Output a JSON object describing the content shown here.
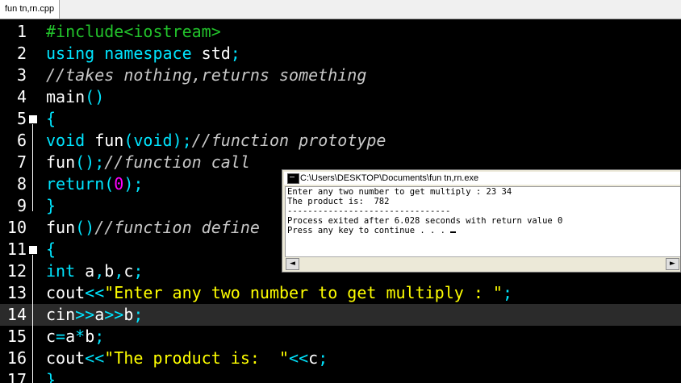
{
  "tab": {
    "label": "fun tn,rn.cpp"
  },
  "editor": {
    "lines": [
      {
        "n": "1",
        "tokens": [
          {
            "t": "#include<iostream>",
            "c": "g"
          }
        ]
      },
      {
        "n": "2",
        "tokens": [
          {
            "t": "using namespace ",
            "c": "cy"
          },
          {
            "t": "std",
            "c": "w"
          },
          {
            "t": ";",
            "c": "cy"
          }
        ]
      },
      {
        "n": "3",
        "tokens": [
          {
            "t": "//takes nothing,returns something",
            "c": "c"
          }
        ]
      },
      {
        "n": "4",
        "tokens": [
          {
            "t": "main",
            "c": "w"
          },
          {
            "t": "()",
            "c": "cy"
          }
        ]
      },
      {
        "n": "5",
        "fold": true,
        "tokens": [
          {
            "t": "{",
            "c": "cy"
          }
        ]
      },
      {
        "n": "6",
        "tokens": [
          {
            "t": "void ",
            "c": "cy"
          },
          {
            "t": "fun",
            "c": "w"
          },
          {
            "t": "(",
            "c": "cy"
          },
          {
            "t": "void",
            "c": "cy"
          },
          {
            "t": ");",
            "c": "cy"
          },
          {
            "t": "//function prototype",
            "c": "c"
          }
        ]
      },
      {
        "n": "7",
        "tokens": [
          {
            "t": "fun",
            "c": "w"
          },
          {
            "t": "();",
            "c": "cy"
          },
          {
            "t": "//function call",
            "c": "c"
          }
        ]
      },
      {
        "n": "8",
        "tokens": [
          {
            "t": "return",
            "c": "cy"
          },
          {
            "t": "(",
            "c": "cy"
          },
          {
            "t": "0",
            "c": "m"
          },
          {
            "t": ");",
            "c": "cy"
          }
        ]
      },
      {
        "n": "9",
        "tokens": [
          {
            "t": "}",
            "c": "cy"
          }
        ]
      },
      {
        "n": "10",
        "tokens": [
          {
            "t": "fun",
            "c": "w"
          },
          {
            "t": "()",
            "c": "cy"
          },
          {
            "t": "//function define",
            "c": "c"
          }
        ]
      },
      {
        "n": "11",
        "fold": true,
        "tokens": [
          {
            "t": "{",
            "c": "cy"
          }
        ]
      },
      {
        "n": "12",
        "tokens": [
          {
            "t": "int ",
            "c": "cy"
          },
          {
            "t": "a",
            "c": "w"
          },
          {
            "t": ",",
            "c": "cy"
          },
          {
            "t": "b",
            "c": "w"
          },
          {
            "t": ",",
            "c": "cy"
          },
          {
            "t": "c",
            "c": "w"
          },
          {
            "t": ";",
            "c": "cy"
          }
        ]
      },
      {
        "n": "13",
        "tokens": [
          {
            "t": "cout",
            "c": "w"
          },
          {
            "t": "<<",
            "c": "cy"
          },
          {
            "t": "\"Enter any two number to get multiply : \"",
            "c": "y"
          },
          {
            "t": ";",
            "c": "cy"
          }
        ]
      },
      {
        "n": "14",
        "current": true,
        "tokens": [
          {
            "t": "cin",
            "c": "w"
          },
          {
            "t": ">>",
            "c": "cy"
          },
          {
            "t": "a",
            "c": "w"
          },
          {
            "t": ">>",
            "c": "cy"
          },
          {
            "t": "b",
            "c": "w"
          },
          {
            "t": ";",
            "c": "cy"
          }
        ]
      },
      {
        "n": "15",
        "tokens": [
          {
            "t": "c",
            "c": "w"
          },
          {
            "t": "=",
            "c": "cy"
          },
          {
            "t": "a",
            "c": "w"
          },
          {
            "t": "*",
            "c": "cy"
          },
          {
            "t": "b",
            "c": "w"
          },
          {
            "t": ";",
            "c": "cy"
          }
        ]
      },
      {
        "n": "16",
        "tokens": [
          {
            "t": "cout",
            "c": "w"
          },
          {
            "t": "<<",
            "c": "cy"
          },
          {
            "t": "\"The product is:  \"",
            "c": "y"
          },
          {
            "t": "<<",
            "c": "cy"
          },
          {
            "t": "c",
            "c": "w"
          },
          {
            "t": ";",
            "c": "cy"
          }
        ]
      },
      {
        "n": "17",
        "tokens": [
          {
            "t": "}",
            "c": "cy"
          }
        ]
      }
    ]
  },
  "console": {
    "title": "C:\\Users\\DESKTOP\\Documents\\fun tn,rn.exe",
    "lines": [
      "Enter any two number to get multiply : 23 34",
      "The product is:  782",
      "--------------------------------",
      "Process exited after 6.028 seconds with return value 0",
      "Press any key to continue . . . "
    ],
    "scroll_left": "◄",
    "scroll_right": "►"
  },
  "colors": {
    "background": "#000000",
    "keyword": "#00e5ff",
    "preprocessor": "#22c22b",
    "string": "#ffff00",
    "number": "#ff00ff",
    "comment": "#c8c8c8",
    "current_line": "#2b2b2b"
  }
}
